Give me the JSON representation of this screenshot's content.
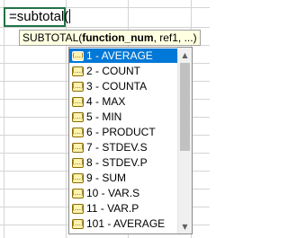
{
  "cell": {
    "formula": "=subtotal("
  },
  "tooltip": {
    "fn": "SUBTOTAL(",
    "arg_current": "function_num",
    "rest": ", ref1, ...)"
  },
  "dropdown": {
    "icon": "function-icon",
    "selected_index": 0,
    "items": [
      "1 - AVERAGE",
      "2 - COUNT",
      "3 - COUNTA",
      "4 - MAX",
      "5 - MIN",
      "6 - PRODUCT",
      "7 - STDEV.S",
      "8 - STDEV.P",
      "9 - SUM",
      "10 - VAR.S",
      "11 - VAR.P",
      "101 - AVERAGE"
    ]
  },
  "colors": {
    "selection": "#0078d7",
    "cell_border": "#217346",
    "tooltip_bg": "#ffffe1"
  }
}
